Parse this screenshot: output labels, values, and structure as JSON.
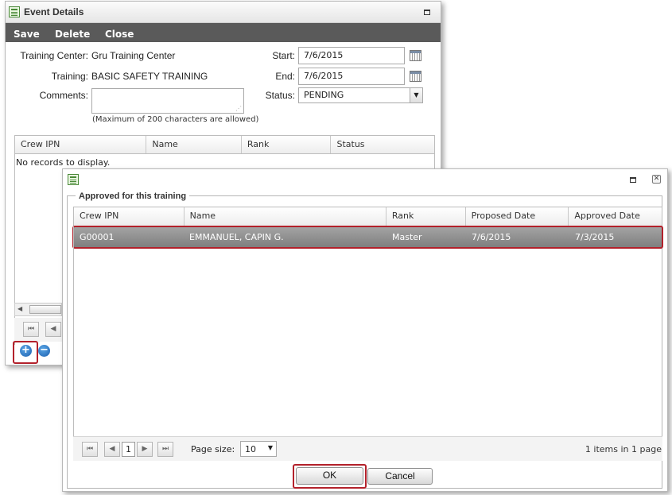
{
  "event_window": {
    "title": "Event Details",
    "toolbar": {
      "save": "Save",
      "delete": "Delete",
      "close": "Close"
    },
    "form": {
      "training_center_label": "Training Center:",
      "training_center_value": "Gru Training Center",
      "training_label": "Training:",
      "training_value": "BASIC SAFETY TRAINING",
      "comments_label": "Comments:",
      "comments_value": "",
      "comments_hint": "(Maximum of 200 characters are allowed)",
      "start_label": "Start:",
      "start_value": "7/6/2015",
      "end_label": "End:",
      "end_value": "7/6/2015",
      "status_label": "Status:",
      "status_value": "PENDING"
    },
    "grid": {
      "columns": [
        "Crew IPN",
        "Name",
        "Rank",
        "Status"
      ],
      "empty_text": "No records to display."
    },
    "add_icon": "plus-circle-icon",
    "remove_icon": "minus-circle-icon"
  },
  "approved_window": {
    "fieldset_legend": "Approved for this training",
    "grid": {
      "columns": [
        "Crew IPN",
        "Name",
        "Rank",
        "Proposed Date",
        "Approved Date"
      ],
      "rows": [
        {
          "crew_ipn": "G00001",
          "name": "EMMANUEL, CAPIN G.",
          "rank": "Master",
          "proposed_date": "7/6/2015",
          "approved_date": "7/3/2015"
        }
      ]
    },
    "pager": {
      "current_page": "1",
      "page_size_label": "Page size:",
      "page_size_value": "10",
      "summary": "1 items in 1 page"
    },
    "ok_label": "OK",
    "cancel_label": "Cancel"
  },
  "colors": {
    "toolbar": "#5a5a5a",
    "selected_row": "#8c8c8c",
    "highlight": "#b3212b",
    "icon_blue": "#1c5fae"
  }
}
